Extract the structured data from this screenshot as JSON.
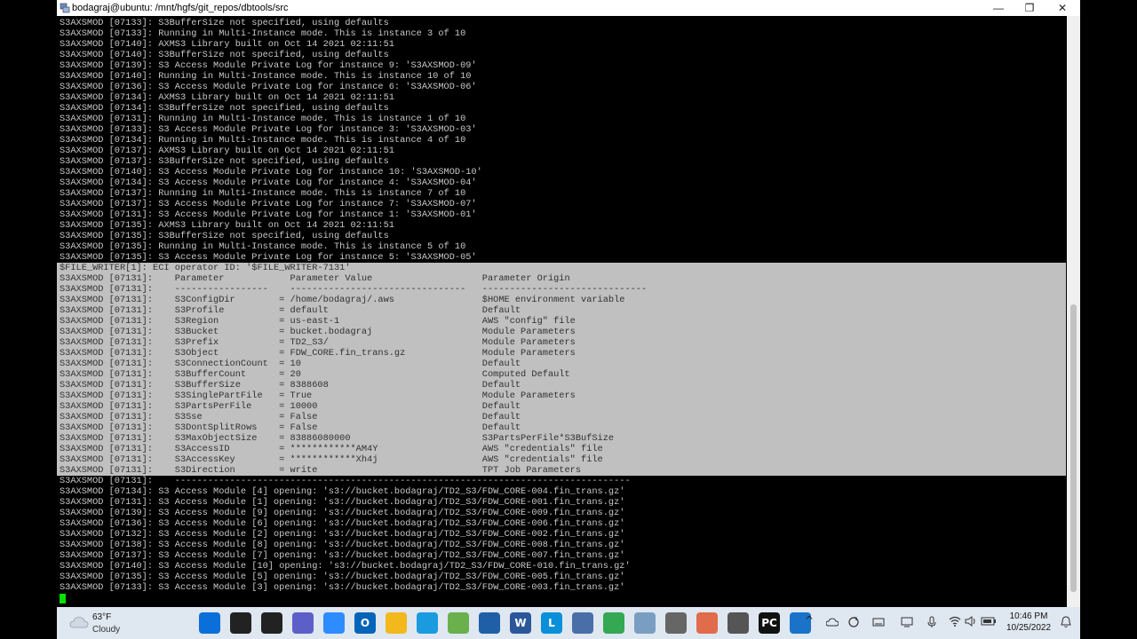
{
  "window": {
    "title": "bodagraj@ubuntu: /mnt/hgfs/git_repos/dbtools/src",
    "controls": {
      "minimize": "—",
      "maximize": "❐",
      "close": "✕"
    }
  },
  "terminal": {
    "lines_before": [
      "S3AXSMOD [07133]: S3BufferSize not specified, using defaults",
      "S3AXSMOD [07133]: Running in Multi-Instance mode. This is instance 3 of 10",
      "S3AXSMOD [07140]: AXMS3 Library built on Oct 14 2021 02:11:51",
      "S3AXSMOD [07140]: S3BufferSize not specified, using defaults",
      "S3AXSMOD [07139]: S3 Access Module Private Log for instance 9: 'S3AXSMOD-09'",
      "S3AXSMOD [07140]: Running in Multi-Instance mode. This is instance 10 of 10",
      "S3AXSMOD [07136]: S3 Access Module Private Log for instance 6: 'S3AXSMOD-06'",
      "S3AXSMOD [07134]: AXMS3 Library built on Oct 14 2021 02:11:51",
      "S3AXSMOD [07134]: S3BufferSize not specified, using defaults",
      "S3AXSMOD [07131]: Running in Multi-Instance mode. This is instance 1 of 10",
      "S3AXSMOD [07133]: S3 Access Module Private Log for instance 3: 'S3AXSMOD-03'",
      "S3AXSMOD [07134]: Running in Multi-Instance mode. This is instance 4 of 10",
      "S3AXSMOD [07137]: AXMS3 Library built on Oct 14 2021 02:11:51",
      "S3AXSMOD [07137]: S3BufferSize not specified, using defaults",
      "S3AXSMOD [07140]: S3 Access Module Private Log for instance 10: 'S3AXSMOD-10'",
      "S3AXSMOD [07134]: S3 Access Module Private Log for instance 4: 'S3AXSMOD-04'",
      "S3AXSMOD [07137]: Running in Multi-Instance mode. This is instance 7 of 10",
      "S3AXSMOD [07137]: S3 Access Module Private Log for instance 7: 'S3AXSMOD-07'",
      "S3AXSMOD [07131]: S3 Access Module Private Log for instance 1: 'S3AXSMOD-01'",
      "S3AXSMOD [07135]: AXMS3 Library built on Oct 14 2021 02:11:51",
      "S3AXSMOD [07135]: S3BufferSize not specified, using defaults",
      "S3AXSMOD [07135]: Running in Multi-Instance mode. This is instance 5 of 10",
      "S3AXSMOD [07135]: S3 Access Module Private Log for instance 5: 'S3AXSMOD-05'"
    ],
    "selected_lines": [
      "$FILE_WRITER[1]: ECI operator ID: '$FILE_WRITER-7131'",
      "S3AXSMOD [07131]:    Parameter            Parameter Value                    Parameter Origin",
      "S3AXSMOD [07131]:    -----------------    --------------------------------   ------------------------------",
      "S3AXSMOD [07131]:    S3ConfigDir        = /home/bodagraj/.aws                $HOME environment variable",
      "S3AXSMOD [07131]:    S3Profile          = default                            Default",
      "S3AXSMOD [07131]:    S3Region           = us-east-1                          AWS \"config\" file",
      "S3AXSMOD [07131]:    S3Bucket           = bucket.bodagraj                    Module Parameters",
      "S3AXSMOD [07131]:    S3Prefix           = TD2_S3/                            Module Parameters",
      "S3AXSMOD [07131]:    S3Object           = FDW_CORE.fin_trans.gz              Module Parameters",
      "S3AXSMOD [07131]:    S3ConnectionCount  = 10                                 Default",
      "S3AXSMOD [07131]:    S3BufferCount      = 20                                 Computed Default",
      "S3AXSMOD [07131]:    S3BufferSize       = 8388608                            Default",
      "S3AXSMOD [07131]:    S3SinglePartFile   = True                               Module Parameters",
      "S3AXSMOD [07131]:    S3PartsPerFile     = 10000                              Default",
      "S3AXSMOD [07131]:    S3Sse              = False                              Default",
      "S3AXSMOD [07131]:    S3DontSplitRows    = False                              Default",
      "S3AXSMOD [07131]:    S3MaxObjectSize    = 83886080000                        S3PartsPerFile*S3BufSize",
      "S3AXSMOD [07131]:    S3AccessID         = ************AM4Y                   AWS \"credentials\" file",
      "S3AXSMOD [07131]:    S3AccessKey        = ************Xh4j                   AWS \"credentials\" file",
      "S3AXSMOD [07131]:    S3Direction        = write                              TPT Job Parameters"
    ],
    "lines_after": [
      "S3AXSMOD [07131]:    -----------------------------------------------------------------------------------",
      "S3AXSMOD [07134]: S3 Access Module [4] opening: 's3://bucket.bodagraj/TD2_S3/FDW_CORE-004.fin_trans.gz'",
      "S3AXSMOD [07131]: S3 Access Module [1] opening: 's3://bucket.bodagraj/TD2_S3/FDW_CORE-001.fin_trans.gz'",
      "S3AXSMOD [07139]: S3 Access Module [9] opening: 's3://bucket.bodagraj/TD2_S3/FDW_CORE-009.fin_trans.gz'",
      "S3AXSMOD [07136]: S3 Access Module [6] opening: 's3://bucket.bodagraj/TD2_S3/FDW_CORE-006.fin_trans.gz'",
      "S3AXSMOD [07132]: S3 Access Module [2] opening: 's3://bucket.bodagraj/TD2_S3/FDW_CORE-002.fin_trans.gz'",
      "S3AXSMOD [07138]: S3 Access Module [8] opening: 's3://bucket.bodagraj/TD2_S3/FDW_CORE-008.fin_trans.gz'",
      "S3AXSMOD [07137]: S3 Access Module [7] opening: 's3://bucket.bodagraj/TD2_S3/FDW_CORE-007.fin_trans.gz'",
      "S3AXSMOD [07140]: S3 Access Module [10] opening: 's3://bucket.bodagraj/TD2_S3/FDW_CORE-010.fin_trans.gz'",
      "S3AXSMOD [07135]: S3 Access Module [5] opening: 's3://bucket.bodagraj/TD2_S3/FDW_CORE-005.fin_trans.gz'",
      "S3AXSMOD [07133]: S3 Access Module [3] opening: 's3://bucket.bodagraj/TD2_S3/FDW_CORE-003.fin_trans.gz'"
    ]
  },
  "taskbar": {
    "weather": {
      "temp": "63°F",
      "condition": "Cloudy"
    },
    "apps": [
      {
        "name": "windows-start",
        "glyph": "",
        "color": "#0a6fd8"
      },
      {
        "name": "search",
        "glyph": "",
        "color": "#222222"
      },
      {
        "name": "task-view",
        "glyph": "",
        "color": "#222222"
      },
      {
        "name": "chat",
        "glyph": "",
        "color": "#5b5fc7"
      },
      {
        "name": "zoom",
        "glyph": "",
        "color": "#2d8cff"
      },
      {
        "name": "outlook",
        "glyph": "O",
        "color": "#0364b8"
      },
      {
        "name": "file-explorer",
        "glyph": "",
        "color": "#f2b81c"
      },
      {
        "name": "edge",
        "glyph": "",
        "color": "#1a9be0"
      },
      {
        "name": "notepad-plus",
        "glyph": "",
        "color": "#6ab04c"
      },
      {
        "name": "store",
        "glyph": "",
        "color": "#1f5fa8"
      },
      {
        "name": "word",
        "glyph": "W",
        "color": "#2b579a"
      },
      {
        "name": "lync",
        "glyph": "L",
        "color": "#0a8fd8"
      },
      {
        "name": "putty",
        "glyph": "",
        "color": "#4a6ea8"
      },
      {
        "name": "chrome",
        "glyph": "",
        "color": "#34a853"
      },
      {
        "name": "photos",
        "glyph": "",
        "color": "#7a9ec2"
      },
      {
        "name": "network-tool",
        "glyph": "",
        "color": "#666666"
      },
      {
        "name": "vs-code-like",
        "glyph": "",
        "color": "#e06c4b"
      },
      {
        "name": "calculator",
        "glyph": "",
        "color": "#555555"
      },
      {
        "name": "pycharm",
        "glyph": "PC",
        "color": "#111111"
      },
      {
        "name": "terminal-app",
        "glyph": "",
        "color": "#1a73c8"
      }
    ],
    "tray": {
      "chevron": "^",
      "time": "10:46 PM",
      "date": "10/25/2022"
    }
  }
}
